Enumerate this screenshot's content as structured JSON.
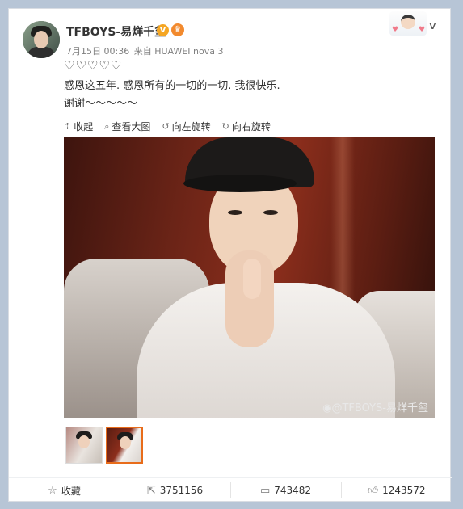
{
  "post": {
    "author": "TFBOYS-易烊千玺",
    "verified_badge": "V",
    "crown_badge": "♛",
    "date": "7月15日 00:36",
    "source_prefix": "来自",
    "source": "HUAWEI nova 3",
    "hearts": "♡♡♡♡♡",
    "text_line1": "感恩这五年. 感恩所有的一切的一切. 我很快乐.",
    "text_line2": "谢谢～～～～～",
    "watermark": "TFBOYS-易烊千玺"
  },
  "media_toolbar": {
    "collapse": "收起",
    "view_large": "查看大图",
    "rotate_left": "向左旋转",
    "rotate_right": "向右旋转"
  },
  "actions": {
    "favorite": "收藏",
    "repost_count": "3751156",
    "comment_count": "743482",
    "like_count": "1243572"
  },
  "icons": [
    "chevron-down-icon",
    "collapse-icon",
    "zoom-icon",
    "rotate-left-icon",
    "rotate-right-icon",
    "star-icon",
    "repost-icon",
    "comment-icon",
    "like-icon",
    "weibo-icon"
  ],
  "colors": {
    "background": "#b7c5d6",
    "badge": "#f5a623",
    "selected_thumb": "#e86c1a"
  }
}
